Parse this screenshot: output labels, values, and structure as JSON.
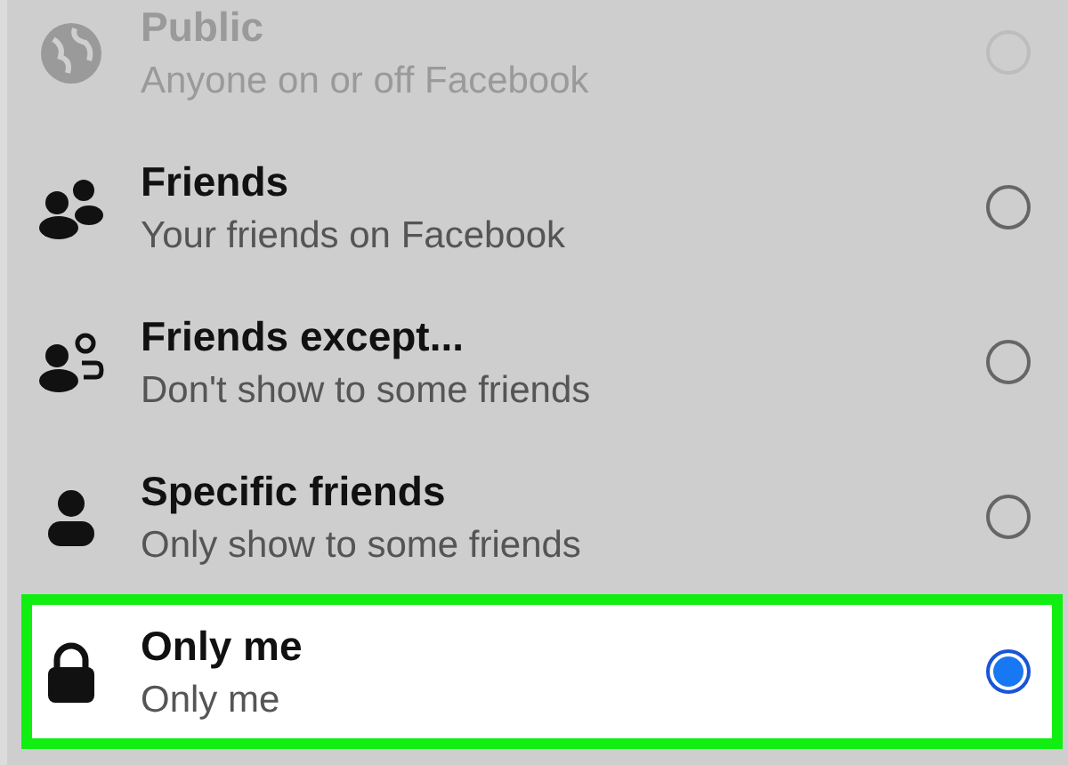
{
  "privacy_options": [
    {
      "title": "Public",
      "subtitle": "Anyone on or off Facebook",
      "disabled": true,
      "selected": false,
      "highlighted": false
    },
    {
      "title": "Friends",
      "subtitle": "Your friends on Facebook",
      "disabled": false,
      "selected": false,
      "highlighted": false
    },
    {
      "title": "Friends except...",
      "subtitle": "Don't show to some friends",
      "disabled": false,
      "selected": false,
      "highlighted": false
    },
    {
      "title": "Specific friends",
      "subtitle": "Only show to some friends",
      "disabled": false,
      "selected": false,
      "highlighted": false
    },
    {
      "title": "Only me",
      "subtitle": "Only me",
      "disabled": false,
      "selected": true,
      "highlighted": true
    }
  ]
}
